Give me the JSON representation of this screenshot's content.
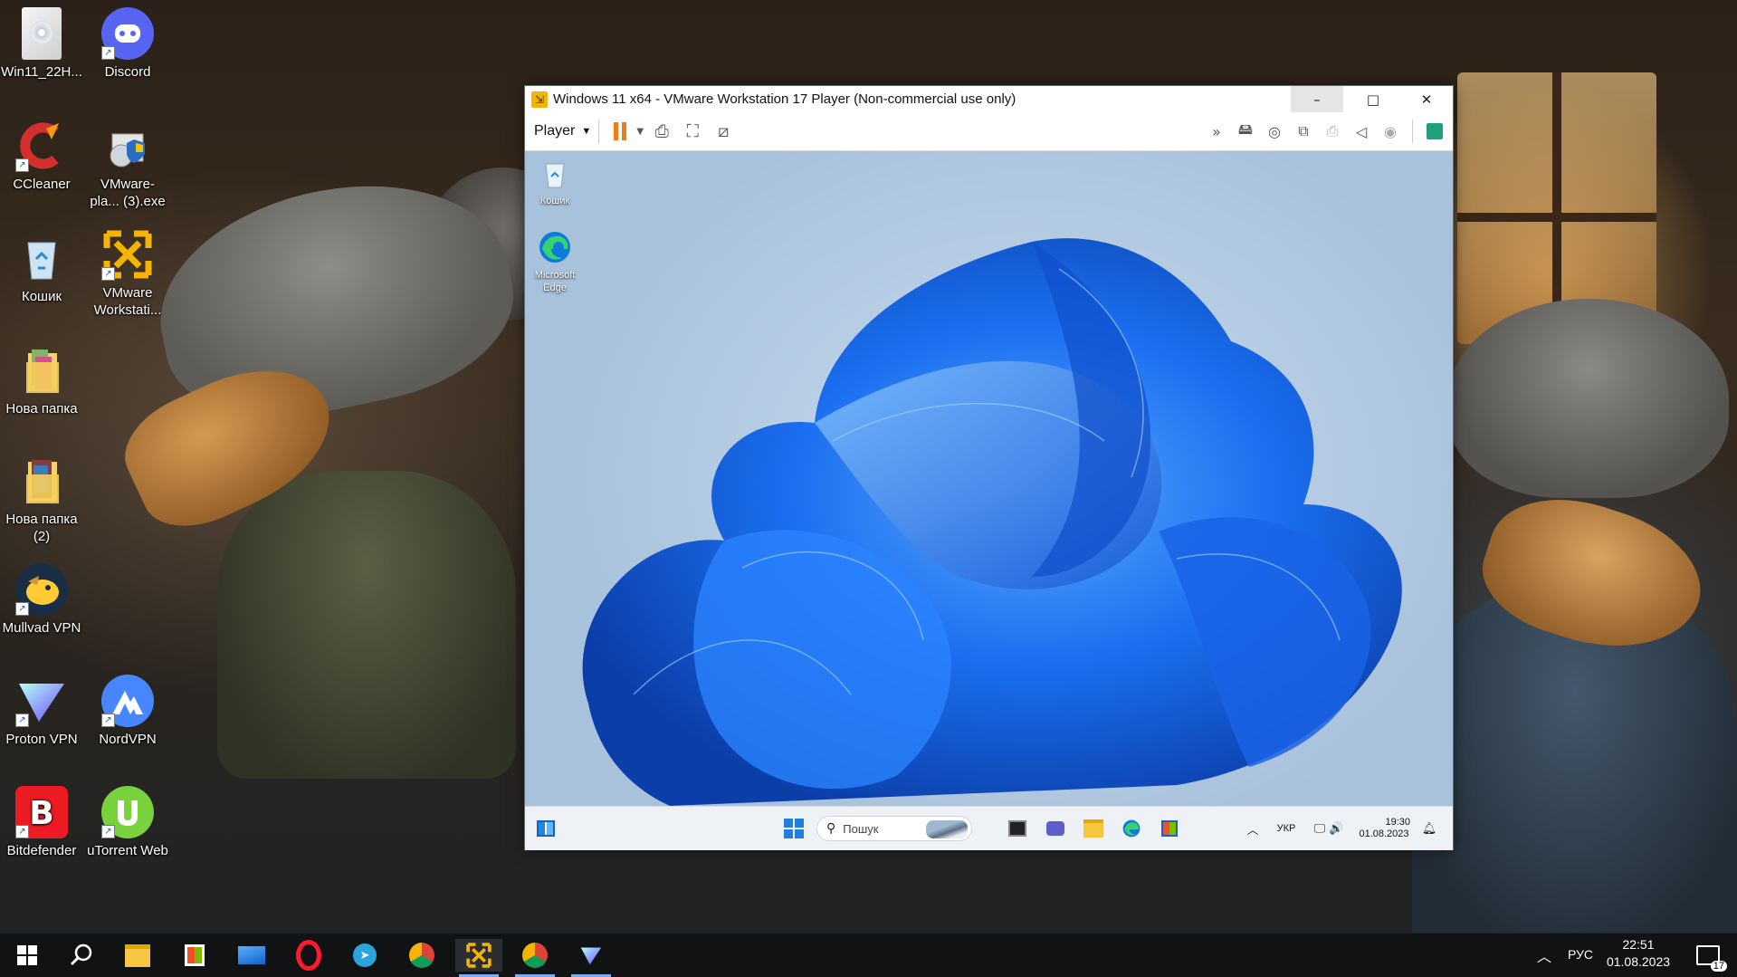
{
  "desktop": {
    "icons": [
      {
        "label": "Win11_22H...",
        "icon": "disc-image-icon"
      },
      {
        "label": "Discord",
        "icon": "discord-icon"
      },
      {
        "label": "CCleaner",
        "icon": "ccleaner-icon"
      },
      {
        "label": "VMware-pla... (3).exe",
        "icon": "vmware-installer-icon"
      },
      {
        "label": "Кошик",
        "icon": "recycle-bin-icon"
      },
      {
        "label": "VMware Workstati...",
        "icon": "vmware-workstation-icon"
      },
      {
        "label": "Нова папка",
        "icon": "folder-icon"
      },
      {
        "label": "Нова папка (2)",
        "icon": "folder-icon"
      },
      {
        "label": "Mullvad VPN",
        "icon": "mullvad-icon"
      },
      {
        "label": "Proton VPN",
        "icon": "protonvpn-icon"
      },
      {
        "label": "NordVPN",
        "icon": "nordvpn-icon"
      },
      {
        "label": "Bitdefender",
        "icon": "bitdefender-icon"
      },
      {
        "label": "uTorrent Web",
        "icon": "utorrent-icon"
      }
    ]
  },
  "vm_window": {
    "title": "Windows 11 x64 - VMware Workstation 17 Player (Non-commercial use only)",
    "player_menu": "Player",
    "controls": {
      "minimize": "–",
      "maximize": "□",
      "close": "✕"
    },
    "guest": {
      "icons": [
        {
          "label": "Кошик"
        },
        {
          "label": "Microsoft Edge"
        }
      ],
      "taskbar": {
        "search_placeholder": "Пошук",
        "lang": "УКР",
        "time": "19:30",
        "date": "01.08.2023"
      }
    }
  },
  "taskbar": {
    "lang": "РУС",
    "time": "22:51",
    "date": "01.08.2023",
    "notification_count": "17"
  },
  "colors": {
    "accent": "#77aef0",
    "bloom": "#1b6ff0"
  }
}
